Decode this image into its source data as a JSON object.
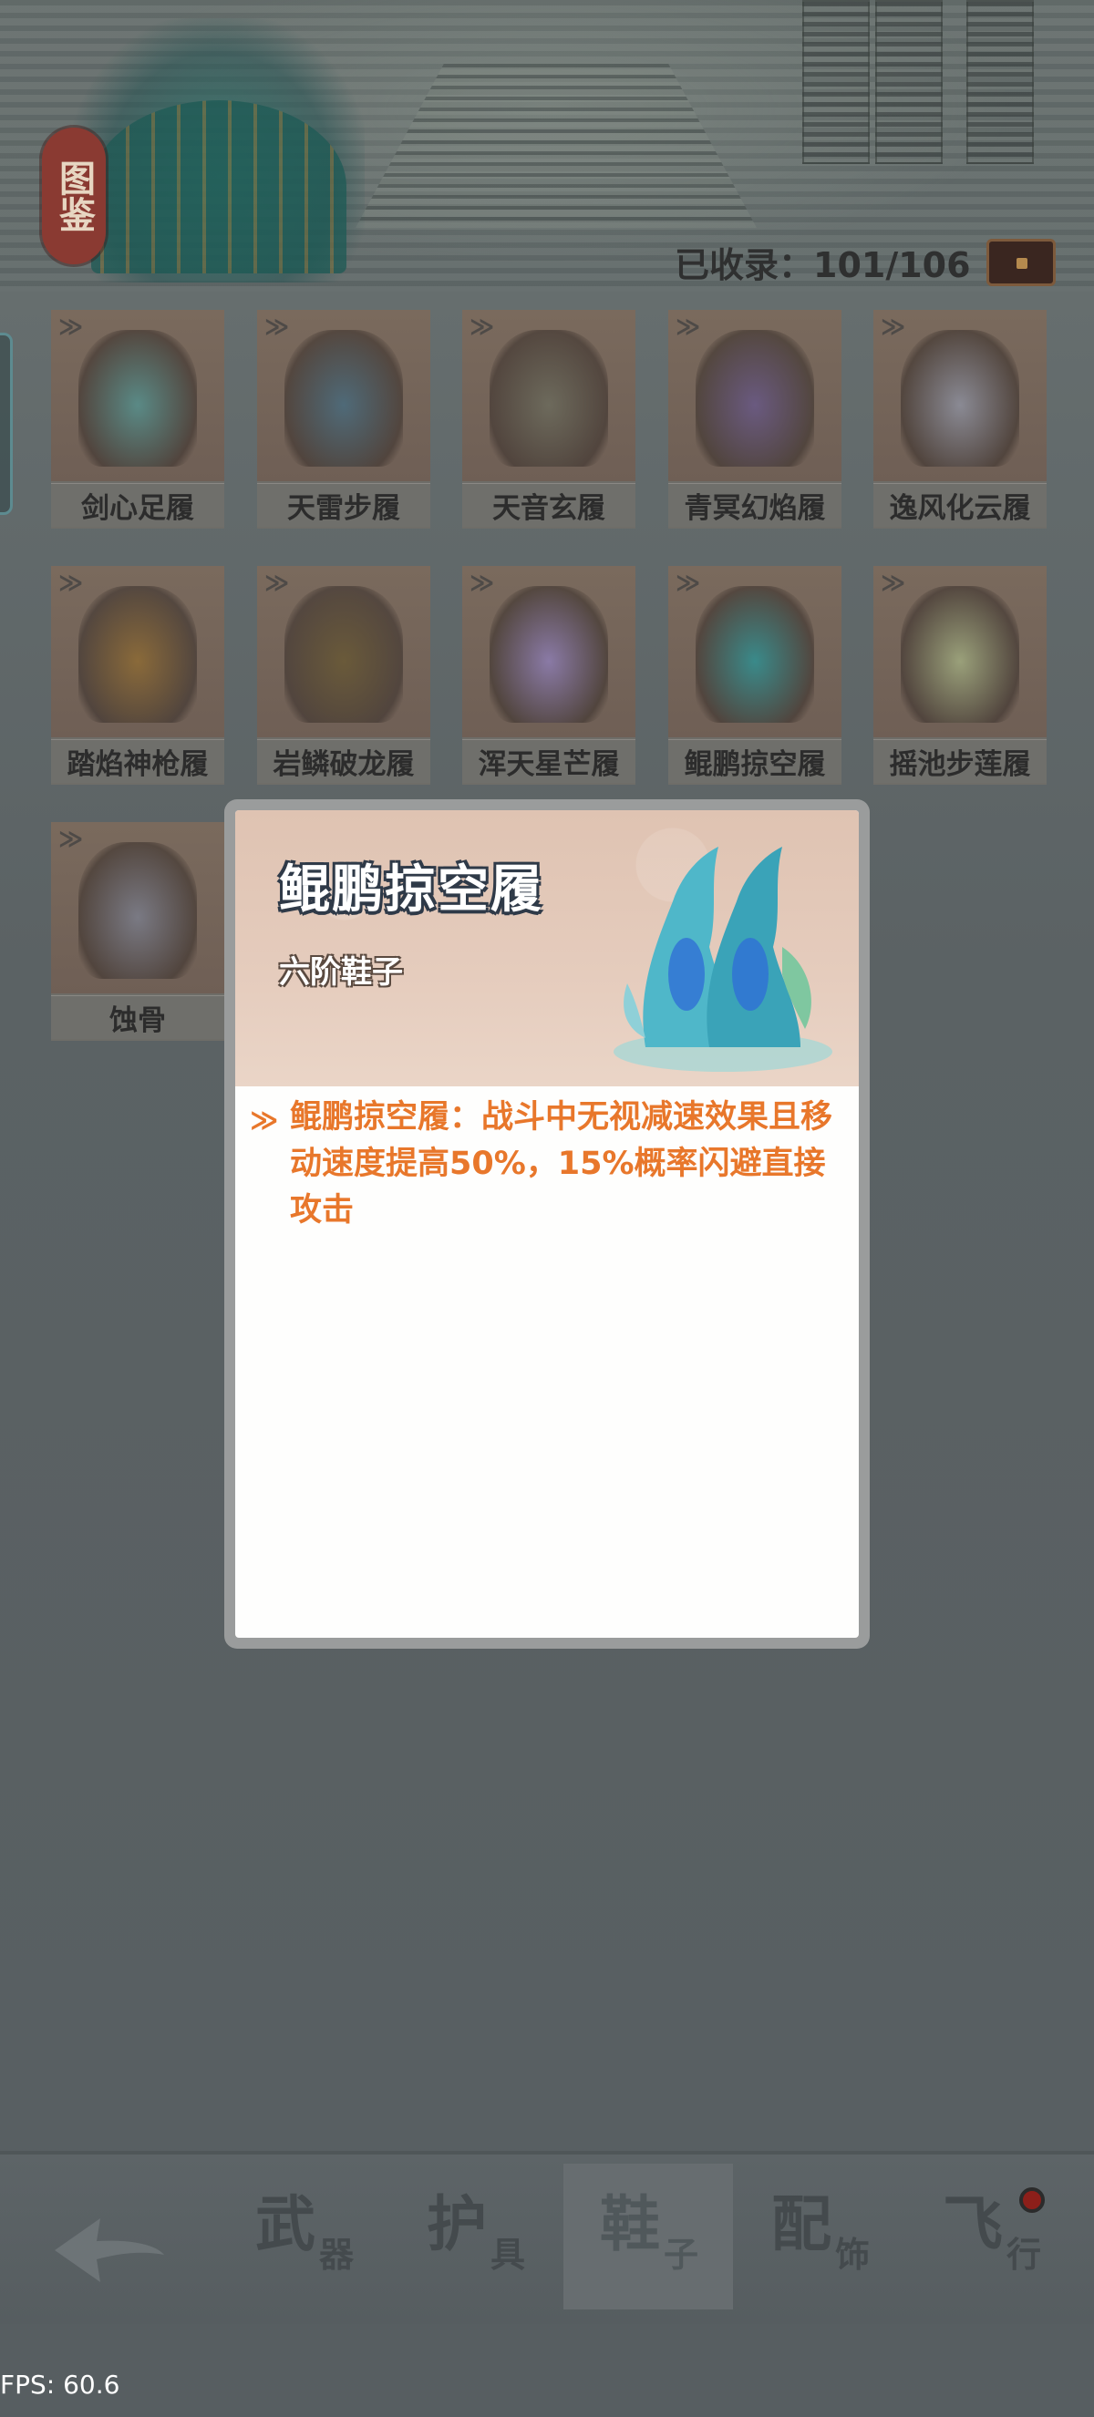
{
  "header": {
    "badge": "图鉴",
    "collected_label": "已收录：101/106",
    "chest_icon": "chest-icon"
  },
  "items": [
    {
      "name": "剑心足履",
      "color": "#5a8a86"
    },
    {
      "name": "天雷步履",
      "color": "#4f6a78"
    },
    {
      "name": "天音玄履",
      "color": "#6d6a5c"
    },
    {
      "name": "青冥幻焰履",
      "color": "#6a5a80"
    },
    {
      "name": "逸风化云履",
      "color": "#8a8a94"
    },
    {
      "name": "踏焰神枪履",
      "color": "#8a6a3a"
    },
    {
      "name": "岩鳞破龙履",
      "color": "#6a5a3a"
    },
    {
      "name": "浑天星芒履",
      "color": "#8a7aa6"
    },
    {
      "name": "鲲鹏掠空履",
      "color": "#3a8a8a"
    },
    {
      "name": "摇池步莲履",
      "color": "#9aa07a"
    },
    {
      "name": "蚀骨",
      "color": "#7a7a84"
    }
  ],
  "popup": {
    "title": "鲲鹏掠空履",
    "subtitle": "六阶鞋子",
    "description": "鲲鹏掠空履：战斗中无视减速效果且移动速度提高50%，15%概率闪避直接攻击",
    "accent": "#e8772b"
  },
  "nav": {
    "back_icon": "back-arrow-icon",
    "tabs": [
      {
        "big": "武",
        "small": "器"
      },
      {
        "big": "护",
        "small": "具"
      },
      {
        "big": "鞋",
        "small": "子"
      },
      {
        "big": "配",
        "small": "饰"
      },
      {
        "big": "飞",
        "small": "行"
      }
    ],
    "active": "鞋子"
  },
  "fps": "FPS: 60.6"
}
